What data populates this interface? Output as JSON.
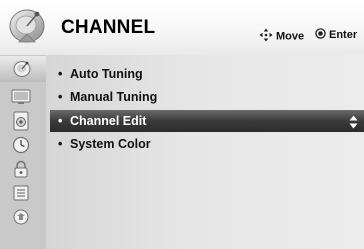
{
  "header": {
    "title": "CHANNEL",
    "hints": [
      {
        "icon": "move-arrows-icon",
        "label": "Move"
      },
      {
        "icon": "ok-button-icon",
        "label": "Enter"
      }
    ]
  },
  "sidebar": {
    "items": [
      {
        "icon": "satellite-dish-icon",
        "active": true
      },
      {
        "icon": "monitor-icon",
        "active": false
      },
      {
        "icon": "speaker-icon",
        "active": false
      },
      {
        "icon": "clock-icon",
        "active": false
      },
      {
        "icon": "lock-icon",
        "active": false
      },
      {
        "icon": "setup-icon",
        "active": false
      },
      {
        "icon": "usb-icon",
        "active": false
      }
    ]
  },
  "menu": {
    "items": [
      {
        "bullet": "•",
        "label": "Auto Tuning"
      },
      {
        "bullet": "•",
        "label": "Manual Tuning"
      },
      {
        "bullet": "•",
        "label": "Channel Edit",
        "selected": true
      },
      {
        "bullet": "•",
        "label": "System Color"
      }
    ]
  },
  "colors": {
    "selection_bar": "#3a3a3a",
    "sidebar_bg": "#c9c9c9",
    "content_bg": "#e6e6e6"
  }
}
